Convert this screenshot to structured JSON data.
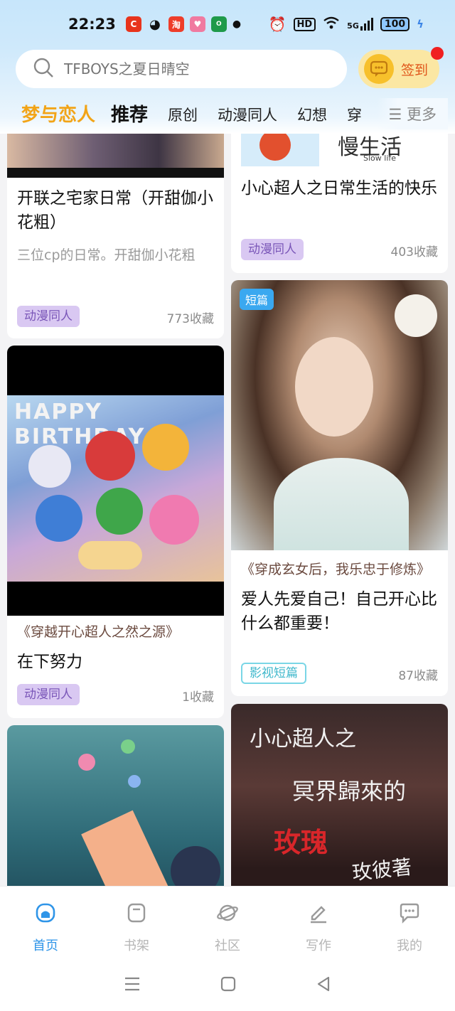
{
  "status_bar": {
    "time": "22:23",
    "hd": "HD",
    "network": "5G",
    "battery": "100"
  },
  "search": {
    "placeholder": "TFBOYS之夏日晴空"
  },
  "signin": {
    "label": "签到"
  },
  "tabs": [
    {
      "label": "梦与恋人"
    },
    {
      "label": "推荐"
    },
    {
      "label": "原创"
    },
    {
      "label": "动漫同人"
    },
    {
      "label": "幻想"
    },
    {
      "label": "穿"
    }
  ],
  "more_label": "☰ 更多",
  "cards": {
    "left1": {
      "title": "开联之宅家日常（开甜伽小花粗）",
      "desc": "三位cp的日常。开甜伽小花粗",
      "tag": "动漫同人",
      "favorites": "773收藏"
    },
    "right1": {
      "cover_text": "慢生活",
      "cover_sub": "Slow life",
      "title": "小心超人之日常生活的快乐",
      "tag": "动漫同人",
      "favorites": "403收藏"
    },
    "left2": {
      "cover_text": "HAPPY BIRTHDAY",
      "quote": "《穿越开心超人之然之源》",
      "title": "在下努力",
      "tag": "动漫同人",
      "favorites": "1收藏"
    },
    "right2": {
      "badge": "短篇",
      "quote": "《穿成玄女后，我乐忠于修炼》",
      "title": "爱人先爱自己！自己开心比什么都重要！",
      "tag": "影视短篇",
      "favorites": "87收藏"
    },
    "right3": {
      "cover_lines": [
        "小心超人之",
        "冥界歸來的",
        "玫瑰",
        "玫彼著"
      ]
    }
  },
  "bottom_nav": [
    {
      "label": "首页",
      "icon": "home-icon"
    },
    {
      "label": "书架",
      "icon": "bookshelf-icon"
    },
    {
      "label": "社区",
      "icon": "planet-icon"
    },
    {
      "label": "写作",
      "icon": "pen-icon"
    },
    {
      "label": "我的",
      "icon": "chat-bubble-icon"
    }
  ]
}
